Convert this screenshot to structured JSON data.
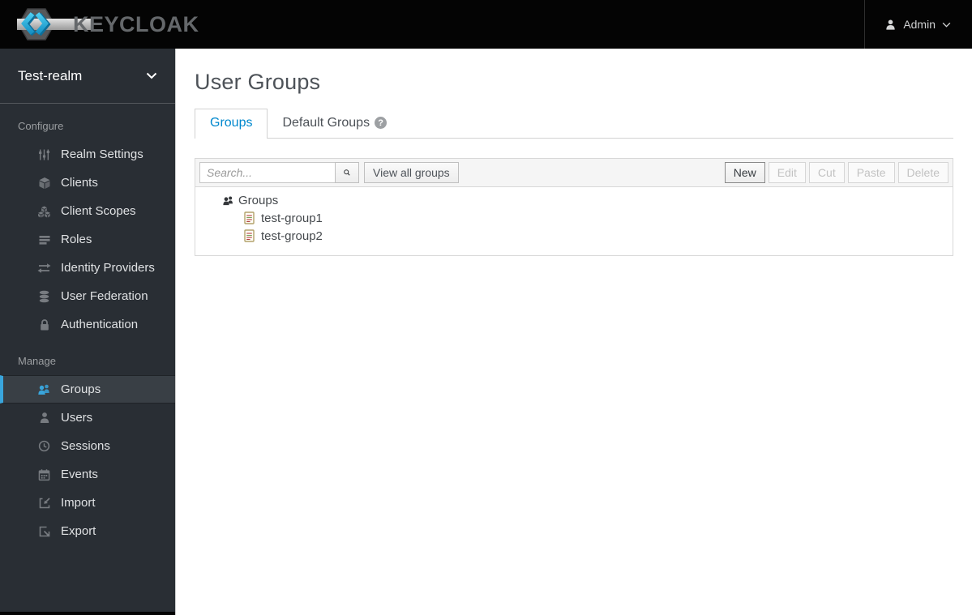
{
  "topbar": {
    "brand": "KEYCLOAK",
    "user_label": "Admin"
  },
  "sidebar": {
    "realm_name": "Test-realm",
    "sections": [
      {
        "label": "Configure",
        "items": [
          {
            "icon": "sliders-icon",
            "label": "Realm Settings"
          },
          {
            "icon": "cube-icon",
            "label": "Clients"
          },
          {
            "icon": "cubes-icon",
            "label": "Client Scopes"
          },
          {
            "icon": "list-icon",
            "label": "Roles"
          },
          {
            "icon": "exchange-icon",
            "label": "Identity Providers"
          },
          {
            "icon": "database-icon",
            "label": "User Federation"
          },
          {
            "icon": "lock-icon",
            "label": "Authentication"
          }
        ]
      },
      {
        "label": "Manage",
        "items": [
          {
            "icon": "users-icon",
            "label": "Groups",
            "active": true
          },
          {
            "icon": "user-icon",
            "label": "Users"
          },
          {
            "icon": "clock-icon",
            "label": "Sessions"
          },
          {
            "icon": "calendar-icon",
            "label": "Events"
          },
          {
            "icon": "import-icon",
            "label": "Import"
          },
          {
            "icon": "export-icon",
            "label": "Export"
          }
        ]
      }
    ]
  },
  "main": {
    "title": "User Groups",
    "tabs": [
      {
        "label": "Groups",
        "active": true
      },
      {
        "label": "Default Groups",
        "has_help_icon": true
      }
    ],
    "toolbar": {
      "search_placeholder": "Search...",
      "view_all_label": "View all groups",
      "actions": [
        {
          "label": "New",
          "enabled": true
        },
        {
          "label": "Edit",
          "enabled": false
        },
        {
          "label": "Cut",
          "enabled": false
        },
        {
          "label": "Paste",
          "enabled": false
        },
        {
          "label": "Delete",
          "enabled": false
        }
      ]
    },
    "tree": {
      "root_label": "Groups",
      "children": [
        "test-group1",
        "test-group2"
      ]
    }
  },
  "colors": {
    "accent_blue": "#39a5dc",
    "active_tab_blue": "#0088ce",
    "topbar_bg": "#040404",
    "sidebar_bg": "#292e34",
    "sidebar_active_bg": "#393f45"
  }
}
